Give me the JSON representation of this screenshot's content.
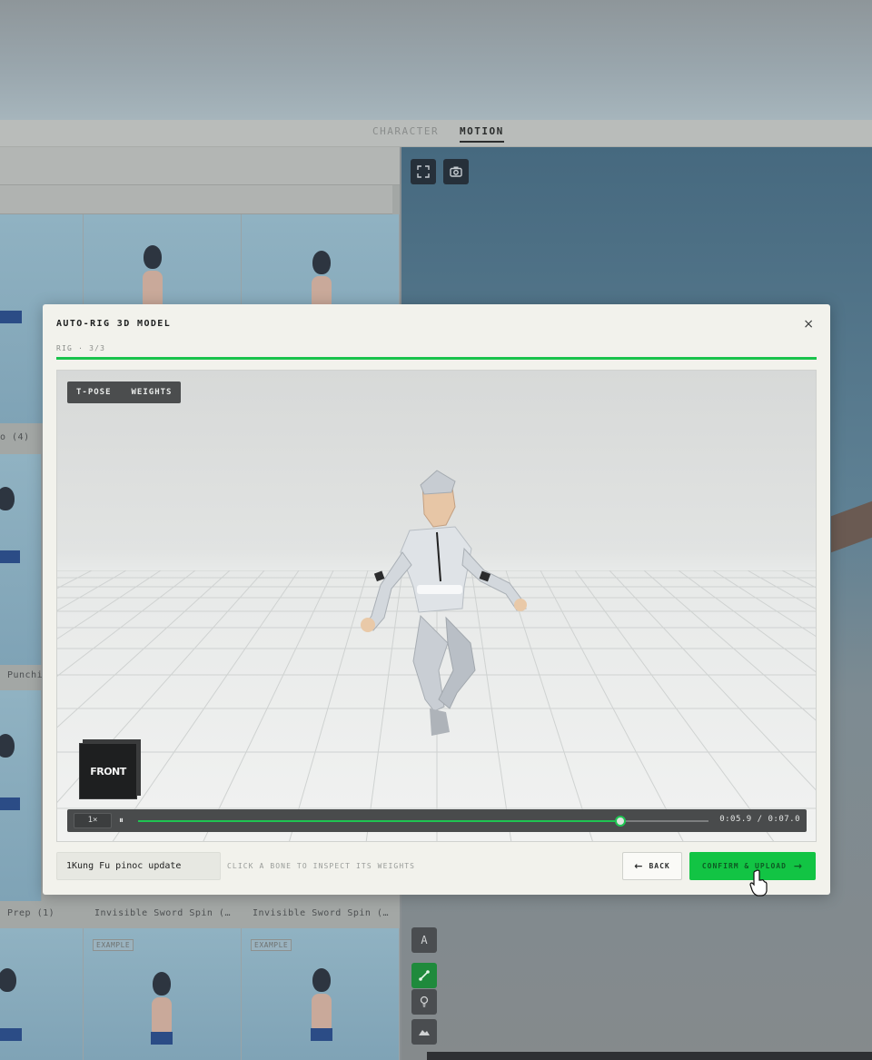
{
  "app": {
    "tabs": [
      {
        "label": "CHARACTER",
        "active": false
      },
      {
        "label": "MOTION",
        "active": true
      }
    ],
    "library": {
      "labels": [
        "o (4)",
        "Punchi",
        "Prep (1)",
        "Invisible Sword Spin (…",
        "Invisible Sword Spin (…"
      ],
      "example_tag": "EXAMPLE"
    },
    "viewport_tools": {
      "fullscreen_icon": "fullscreen-icon",
      "camera_icon": "camera-icon",
      "side_tools": [
        "A",
        "bone",
        "light",
        "terrain"
      ]
    }
  },
  "modal": {
    "title": "AUTO-RIG 3D MODEL",
    "close_label": "×",
    "step_label": "RIG · 3/3",
    "progress": 1.0,
    "toggle": {
      "tpose": "T-POSE",
      "weights": "WEIGHTS"
    },
    "view_cube_label": "FRONT",
    "playback": {
      "speed": "1×",
      "pause_glyph": "⏸",
      "position": 0.8463,
      "time": "0:05.9 / 0:07.0"
    },
    "name_value": "1Kung Fu pinoc update",
    "hint": "CLICK A BONE TO INSPECT ITS WEIGHTS",
    "back_label": "BACK",
    "confirm_label": "CONFIRM & UPLOAD"
  },
  "colors": {
    "accent": "#12c444",
    "modal_bg": "#f2f2ec",
    "toolbar_dark": "#494b4c"
  }
}
